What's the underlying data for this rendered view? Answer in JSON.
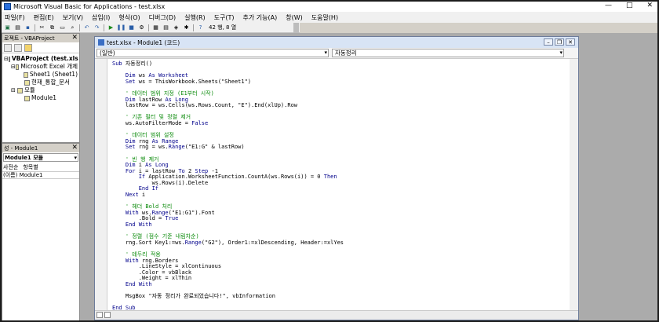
{
  "window": {
    "title": "Microsoft Visual Basic for Applications - test.xlsx",
    "controls": [
      "—",
      "□",
      "✕"
    ]
  },
  "menu": [
    "파일(F)",
    "편집(E)",
    "보기(V)",
    "삽입(I)",
    "형식(O)",
    "디버그(D)",
    "실행(R)",
    "도구(T)",
    "추가 기능(A)",
    "창(W)",
    "도움말(H)"
  ],
  "toolbar": {
    "position": "42 행, 8 열"
  },
  "project": {
    "title": "로젝트 - VBAProject",
    "tree": [
      {
        "label": "VBAProject (test.xls",
        "indent": 0,
        "glyph": "⊟",
        "bold": true
      },
      {
        "label": "Microsoft Excel 개체",
        "indent": 1,
        "glyph": "⊟",
        "bold": false
      },
      {
        "label": "Sheet1 (Sheet1)",
        "indent": 2,
        "glyph": "",
        "bold": false
      },
      {
        "label": "현재_통합_문서",
        "indent": 2,
        "glyph": "",
        "bold": false
      },
      {
        "label": "모듈",
        "indent": 1,
        "glyph": "⊟",
        "bold": false
      },
      {
        "label": "Module1",
        "indent": 2,
        "glyph": "",
        "bold": false
      }
    ]
  },
  "properties": {
    "title": "성 - Module1",
    "selected": "Module1 모듈",
    "tabs": [
      "사전순",
      "항목별"
    ],
    "row": "(이름) Module1"
  },
  "code_window": {
    "title": "test.xlsx - Module1 (코드)",
    "object_combo": "(일반)",
    "proc_combo": "자동정리",
    "lines": [
      "Sub 자동정리()",
      "",
      "    Dim ws As Worksheet",
      "    Set ws = ThisWorkbook.Sheets(\"Sheet1\")",
      "",
      "    ' 데이터 범위 지정 (E1부터 시작)",
      "    Dim lastRow As Long",
      "    lastRow = ws.Cells(ws.Rows.Count, \"E\").End(xlUp).Row",
      "",
      "    ' 기존 필터 및 정렬 제거",
      "    ws.AutoFilterMode = False",
      "",
      "    ' 데이터 범위 설정",
      "    Dim rng As Range",
      "    Set rng = ws.Range(\"E1:G\" & lastRow)",
      "",
      "    ' 빈 행 제거",
      "    Dim i As Long",
      "    For i = lastRow To 2 Step -1",
      "        If Application.WorksheetFunction.CountA(ws.Rows(i)) = 0 Then",
      "            ws.Rows(i).Delete",
      "        End If",
      "    Next i",
      "",
      "    ' 헤더 Bold 처리",
      "    With ws.Range(\"E1:G1\").Font",
      "        .Bold = True",
      "    End With",
      "",
      "    ' 정렬 (점수 기준 내림차순)",
      "    rng.Sort Key1:=ws.Range(\"G2\"), Order1:=xlDescending, Header:=xlYes",
      "",
      "    ' 테두리 적용",
      "    With rng.Borders",
      "        .LineStyle = xlContinuous",
      "        .Color = vbBlack",
      "        .Weight = xlThin",
      "    End With",
      "",
      "    MsgBox \"자동 정리가 완료되었습니다!\", vbInformation",
      "",
      "End Sub"
    ]
  },
  "colors": {
    "keyword": "#00008b",
    "comment": "#0a8a0a",
    "code_title_bg": "#d8e4f5"
  }
}
